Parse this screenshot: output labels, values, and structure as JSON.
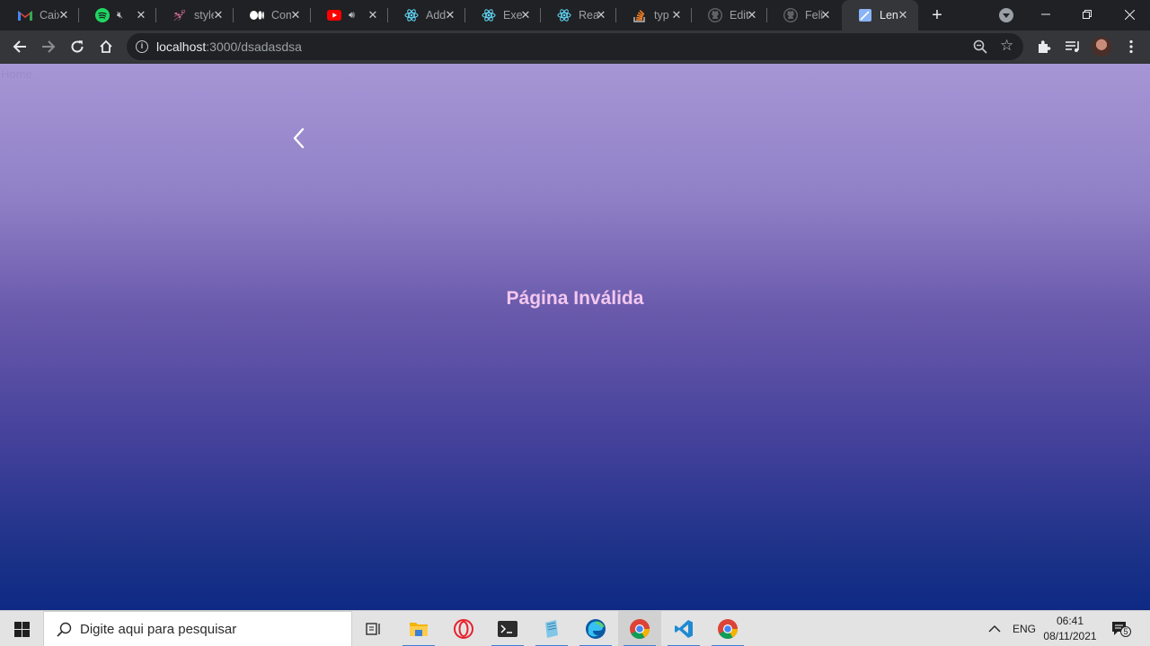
{
  "browser": {
    "tabs": [
      {
        "title": "Caixa",
        "favicon": "gmail-icon"
      },
      {
        "title": "",
        "favicon": "spotify-icon",
        "audio": "muted-speaker-icon"
      },
      {
        "title": "styled",
        "favicon": "styled-components-icon"
      },
      {
        "title": "Com",
        "favicon": "medium-icon"
      },
      {
        "title": "",
        "favicon": "youtube-icon",
        "audio": "speaker-icon"
      },
      {
        "title": "Add",
        "favicon": "react-icon"
      },
      {
        "title": "Exer",
        "favicon": "react-icon"
      },
      {
        "title": "Rea",
        "favicon": "react-icon"
      },
      {
        "title": "typ",
        "favicon": "stackoverflow-icon"
      },
      {
        "title": "Edit",
        "favicon": "github-icon"
      },
      {
        "title": "Feli",
        "favicon": "github-icon"
      },
      {
        "title": "Len",
        "favicon": "page-icon",
        "active": true
      }
    ],
    "address": {
      "host": "localhost",
      "path": ":3000/dsadasdsa"
    }
  },
  "page": {
    "home_link": "Home",
    "message": "Página Inválida",
    "colors": {
      "gradient_top": "#a796d5",
      "gradient_bottom": "#0e2a84",
      "message": "#f3c7ee"
    }
  },
  "taskbar": {
    "search_placeholder": "Digite aqui para pesquisar",
    "language": "ENG",
    "time": "06:41",
    "date": "08/11/2021",
    "notification_count": "5"
  }
}
